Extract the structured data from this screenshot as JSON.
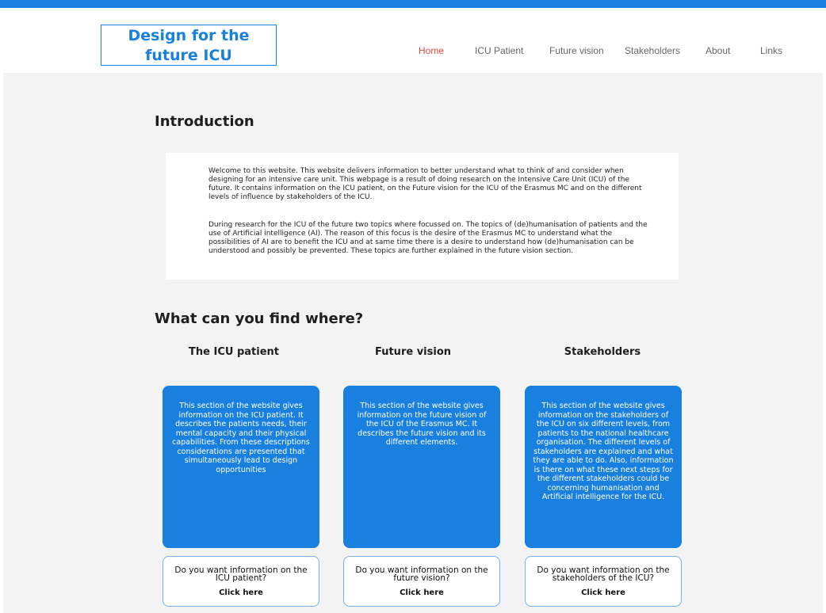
{
  "header": {
    "logo_line1": "Design for the",
    "logo_line2": "future ICU",
    "nav": [
      "Home",
      "ICU Patient",
      "Future vision",
      "Stakeholders",
      "About",
      "Links"
    ],
    "active_nav": "Home"
  },
  "intro": {
    "heading": "Introduction",
    "p1": "Welcome to this website. This website delivers information to better understand what to think of and consider when designing for an intensive care unit. This webpage is a result of doing research on the Intensive Care Unit (ICU) of the future. It contains information on the ICU patient, on the Future vision for the ICU of the Erasmus MC and on the different levels of influence by stakeholders of the ICU.",
    "p2": "During research for the ICU of the future two topics where focussed on. The topics of (de)humanisation of patients and the use of Artificial intelligence (AI). The reason of this focus is the desire of the Erasmus MC to understand what the possibilities of AI are to benefit the ICU and at same time there is a desire to understand how (de)humanisation can be understood and possibly be prevented. These topics are further explained in the future vision section."
  },
  "where": {
    "heading": "What can you find where?",
    "columns": [
      {
        "title": "The ICU patient",
        "description": "This section of the website gives information on the ICU patient. It describes the patients needs, their mental capacity and their physical capabilities. From these descriptions considerations are presented that simultaneously lead to design opportunities",
        "question": "Do you want information on the ICU patient?",
        "click": "Click here"
      },
      {
        "title": "Future vision",
        "description": "This section of the website gives information on the future vision of the ICU of the Erasmus MC. It describes the future vision and its different elements.",
        "question": "Do you want information on the future vision?",
        "click": "Click here"
      },
      {
        "title": "Stakeholders",
        "description": "This section of the website gives information on the stakeholders of the ICU on six different levels, from patients to the national healthcare organisation. The different levels of stakeholders are explained and what they are able to do. Also, information is there on what these next steps for the different stakeholders could be concerning humanisation and Artificial intelligence for the ICU.",
        "question": "Do you want information on the stakeholders of the ICU?",
        "click": "Click here"
      }
    ]
  },
  "colors": {
    "accent": "#1a80e0",
    "active_nav": "#e8473d",
    "background": "#f3f3f3"
  }
}
